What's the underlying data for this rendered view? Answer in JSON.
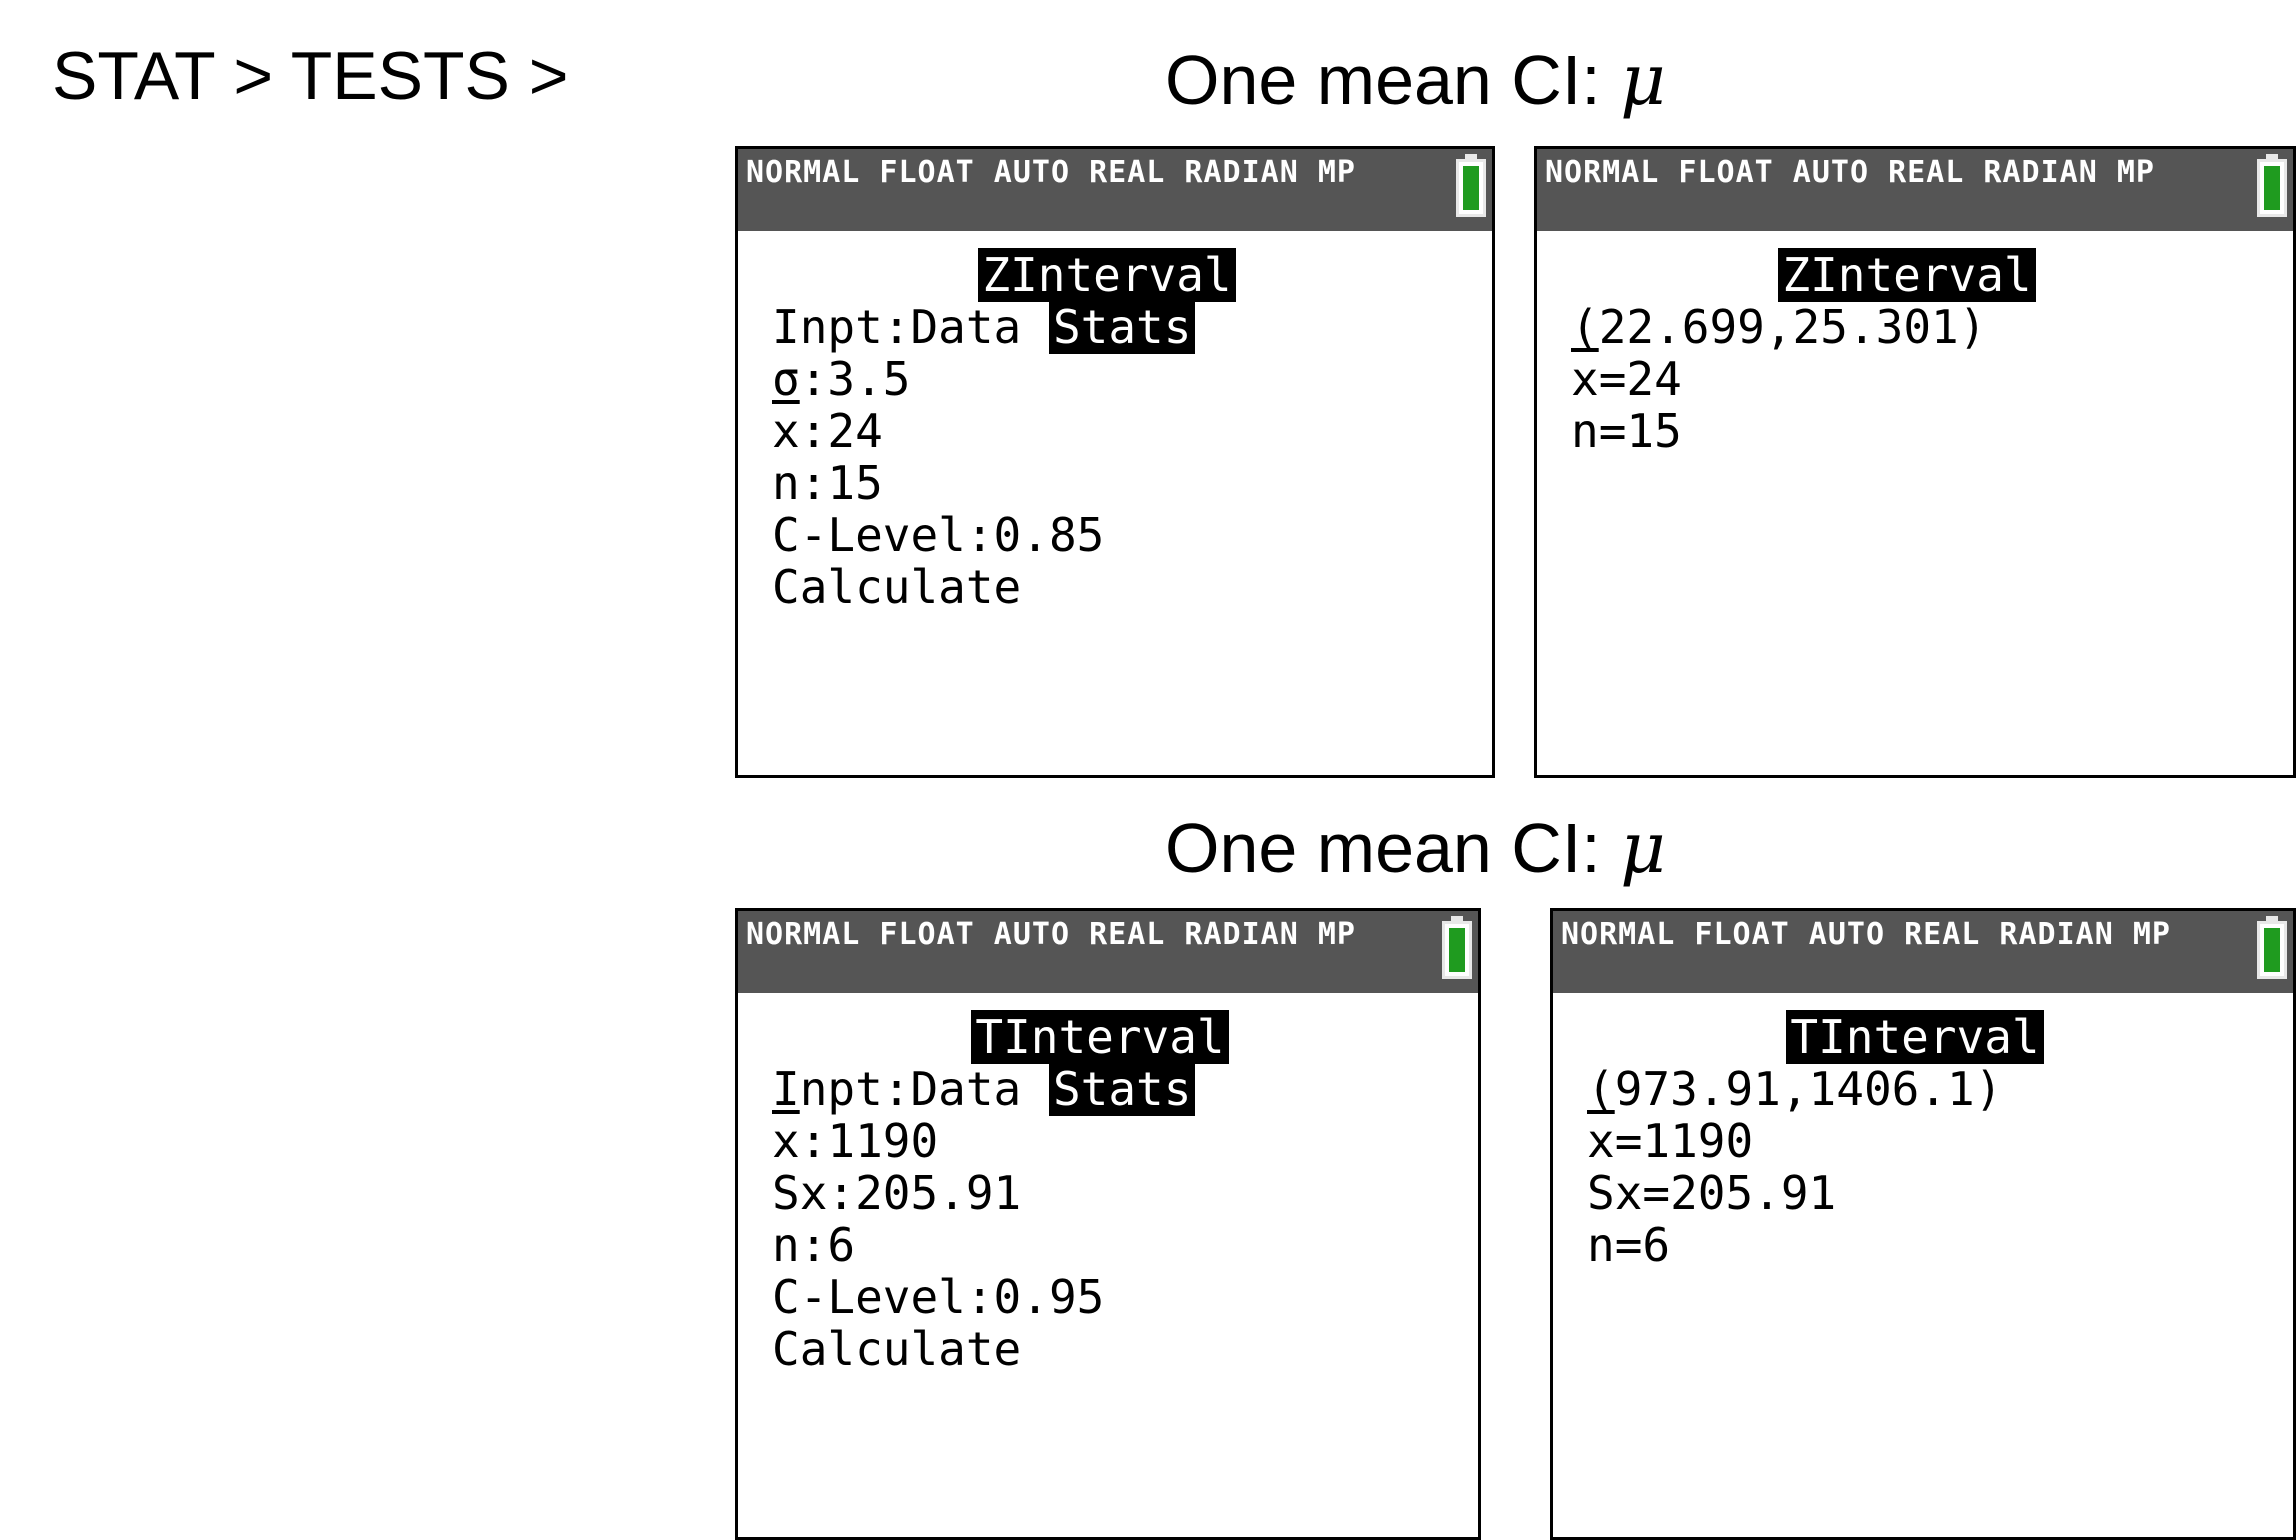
{
  "nav_path": "STAT > TESTS >",
  "sections": [
    {
      "title": "One mean CI:",
      "symbol": "μ"
    },
    {
      "title": "One mean CI:",
      "symbol": "μ"
    }
  ],
  "status_bar_text": "NORMAL FLOAT AUTO REAL RADIAN MP",
  "icons": {
    "battery": "battery-icon"
  },
  "colors": {
    "status_bar": "#555555",
    "battery_fill": "#1f9b1f",
    "highlight": "#000000"
  },
  "zinterval_input": {
    "title": "ZInterval",
    "inpt_label": "Inpt:Data ",
    "inpt_selected": "Stats",
    "sigma": "σ:3.5",
    "xbar_symbol": "x",
    "xbar_value": ":24",
    "n": "n:15",
    "clevel": "C-Level:0.85",
    "calculate": "Calculate"
  },
  "zinterval_result": {
    "title": "ZInterval",
    "interval": "(22.699,25.301)",
    "xbar_symbol": "x",
    "xbar_value": "=24",
    "n": "n=15"
  },
  "tinterval_input": {
    "title": "TInterval",
    "inpt_label": "Inpt:Data ",
    "inpt_selected": "Stats",
    "xbar_symbol": "x",
    "xbar_value": ":1190",
    "sx": "Sx:205.91",
    "n": "n:6",
    "clevel": "C-Level:0.95",
    "calculate": "Calculate"
  },
  "tinterval_result": {
    "title": "TInterval",
    "interval": "(973.91,1406.1)",
    "xbar_symbol": "x",
    "xbar_value": "=1190",
    "sx": "Sx=205.91",
    "n": "n=6"
  }
}
